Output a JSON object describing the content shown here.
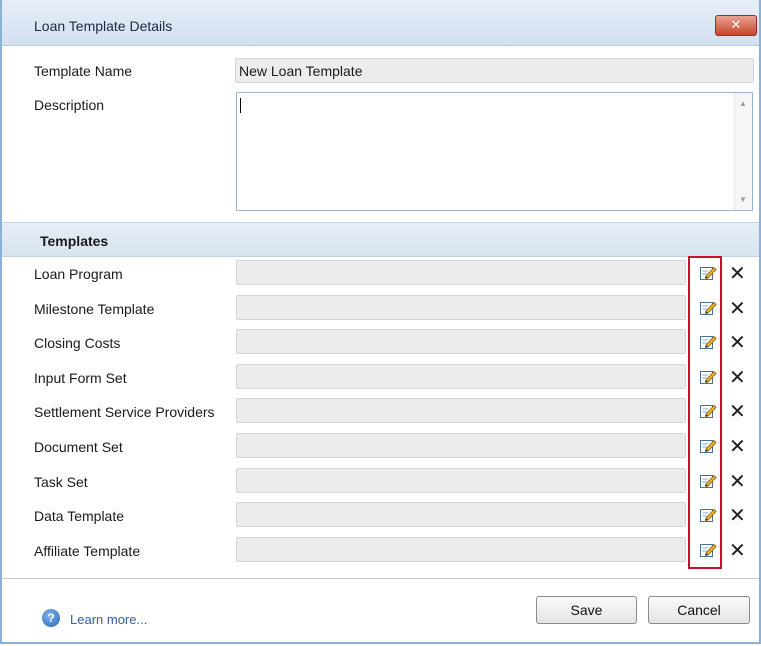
{
  "window": {
    "title": "Loan Template Details",
    "close_glyph": "✕"
  },
  "form": {
    "template_name_label": "Template Name",
    "template_name_value": "New Loan Template",
    "description_label": "Description",
    "description_value": ""
  },
  "templates": {
    "header": "Templates",
    "rows": [
      {
        "label": "Loan Program",
        "value": ""
      },
      {
        "label": "Milestone Template",
        "value": ""
      },
      {
        "label": "Closing Costs",
        "value": ""
      },
      {
        "label": "Input Form Set",
        "value": ""
      },
      {
        "label": "Settlement Service Providers",
        "value": ""
      },
      {
        "label": "Document Set",
        "value": ""
      },
      {
        "label": "Task Set",
        "value": ""
      },
      {
        "label": "Data Template",
        "value": ""
      },
      {
        "label": "Affiliate Template",
        "value": ""
      }
    ],
    "edit_icon": "edit-icon",
    "delete_icon": "delete-icon",
    "delete_glyph": "✕",
    "highlight_color": "#c8102e"
  },
  "footer": {
    "help_glyph": "?",
    "learn_more": "Learn more...",
    "save_label": "Save",
    "cancel_label": "Cancel"
  }
}
